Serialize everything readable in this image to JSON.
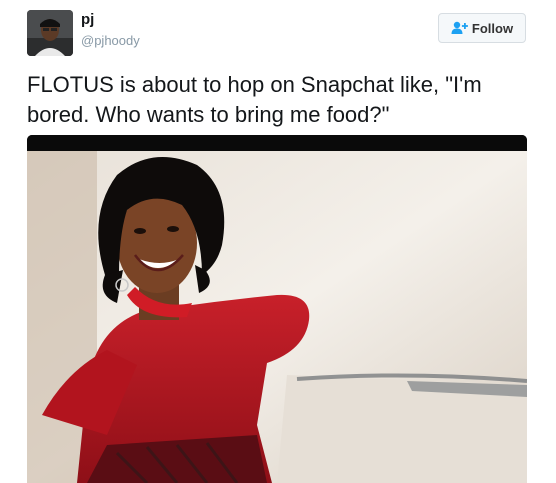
{
  "tweet": {
    "author": {
      "display_name": "pj",
      "username": "@pjhoody"
    },
    "follow_label": "Follow",
    "text": "FLOTUS is about to hop on Snapchat like, \"I'm bored. Who wants to bring me food?\"",
    "media": {
      "kind": "photo",
      "icon": "photo-icon"
    }
  },
  "colors": {
    "username": "#8899a6",
    "follow_icon": "#1da1f2",
    "follow_bg": "#f5f8fa",
    "text": "#14171a"
  }
}
